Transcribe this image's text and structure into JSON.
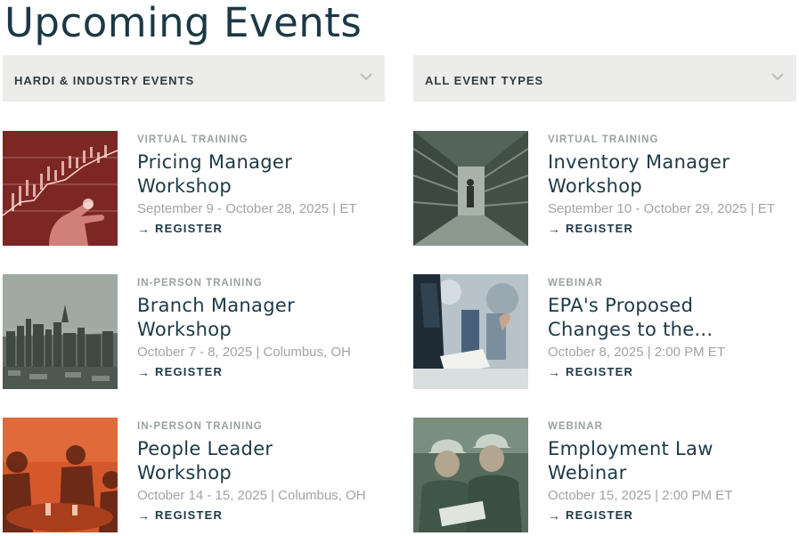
{
  "page": {
    "title": "Upcoming Events"
  },
  "filters": [
    {
      "label": "HARDI & INDUSTRY EVENTS",
      "icon": "chevron-down-icon"
    },
    {
      "label": "ALL EVENT TYPES",
      "icon": "chevron-down-icon"
    }
  ],
  "events": [
    {
      "type": "VIRTUAL TRAINING",
      "title_lines": [
        "Pricing Manager",
        "Workshop"
      ],
      "date": "September 9 - October 28, 2025 | ET",
      "register": "REGISTER",
      "image": "finance-chart-hand-photo",
      "tint": "#8a2f2b"
    },
    {
      "type": "VIRTUAL TRAINING",
      "title_lines": [
        "Inventory Manager",
        "Workshop"
      ],
      "date": "September 10 - October 29, 2025 | ET",
      "register": "REGISTER",
      "image": "warehouse-aisle-photo",
      "tint": "#6d7d70"
    },
    {
      "type": "IN-PERSON TRAINING",
      "title_lines": [
        "Branch Manager",
        "Workshop"
      ],
      "date": "October 7 - 8, 2025 | Columbus, OH",
      "register": "REGISTER",
      "image": "city-skyline-photo",
      "tint": "#7c8a80"
    },
    {
      "type": "WEBINAR",
      "title_lines": [
        "EPA's Proposed",
        "Changes to the..."
      ],
      "date": "October 8, 2025 | 2:00 PM ET",
      "register": "REGISTER",
      "image": "office-meeting-photo",
      "tint": "#2e4c67"
    },
    {
      "type": "IN-PERSON TRAINING",
      "title_lines": [
        "People Leader",
        "Workshop"
      ],
      "date": "October 14 - 15, 2025 | Columbus, OH",
      "register": "REGISTER",
      "image": "team-discussion-photo",
      "tint": "#d5582c"
    },
    {
      "type": "WEBINAR",
      "title_lines": [
        "Employment Law",
        "Webinar"
      ],
      "date": "October 15, 2025 | 2:00 PM ET",
      "register": "REGISTER",
      "image": "hardhat-workers-photo",
      "tint": "#6f8572"
    }
  ]
}
